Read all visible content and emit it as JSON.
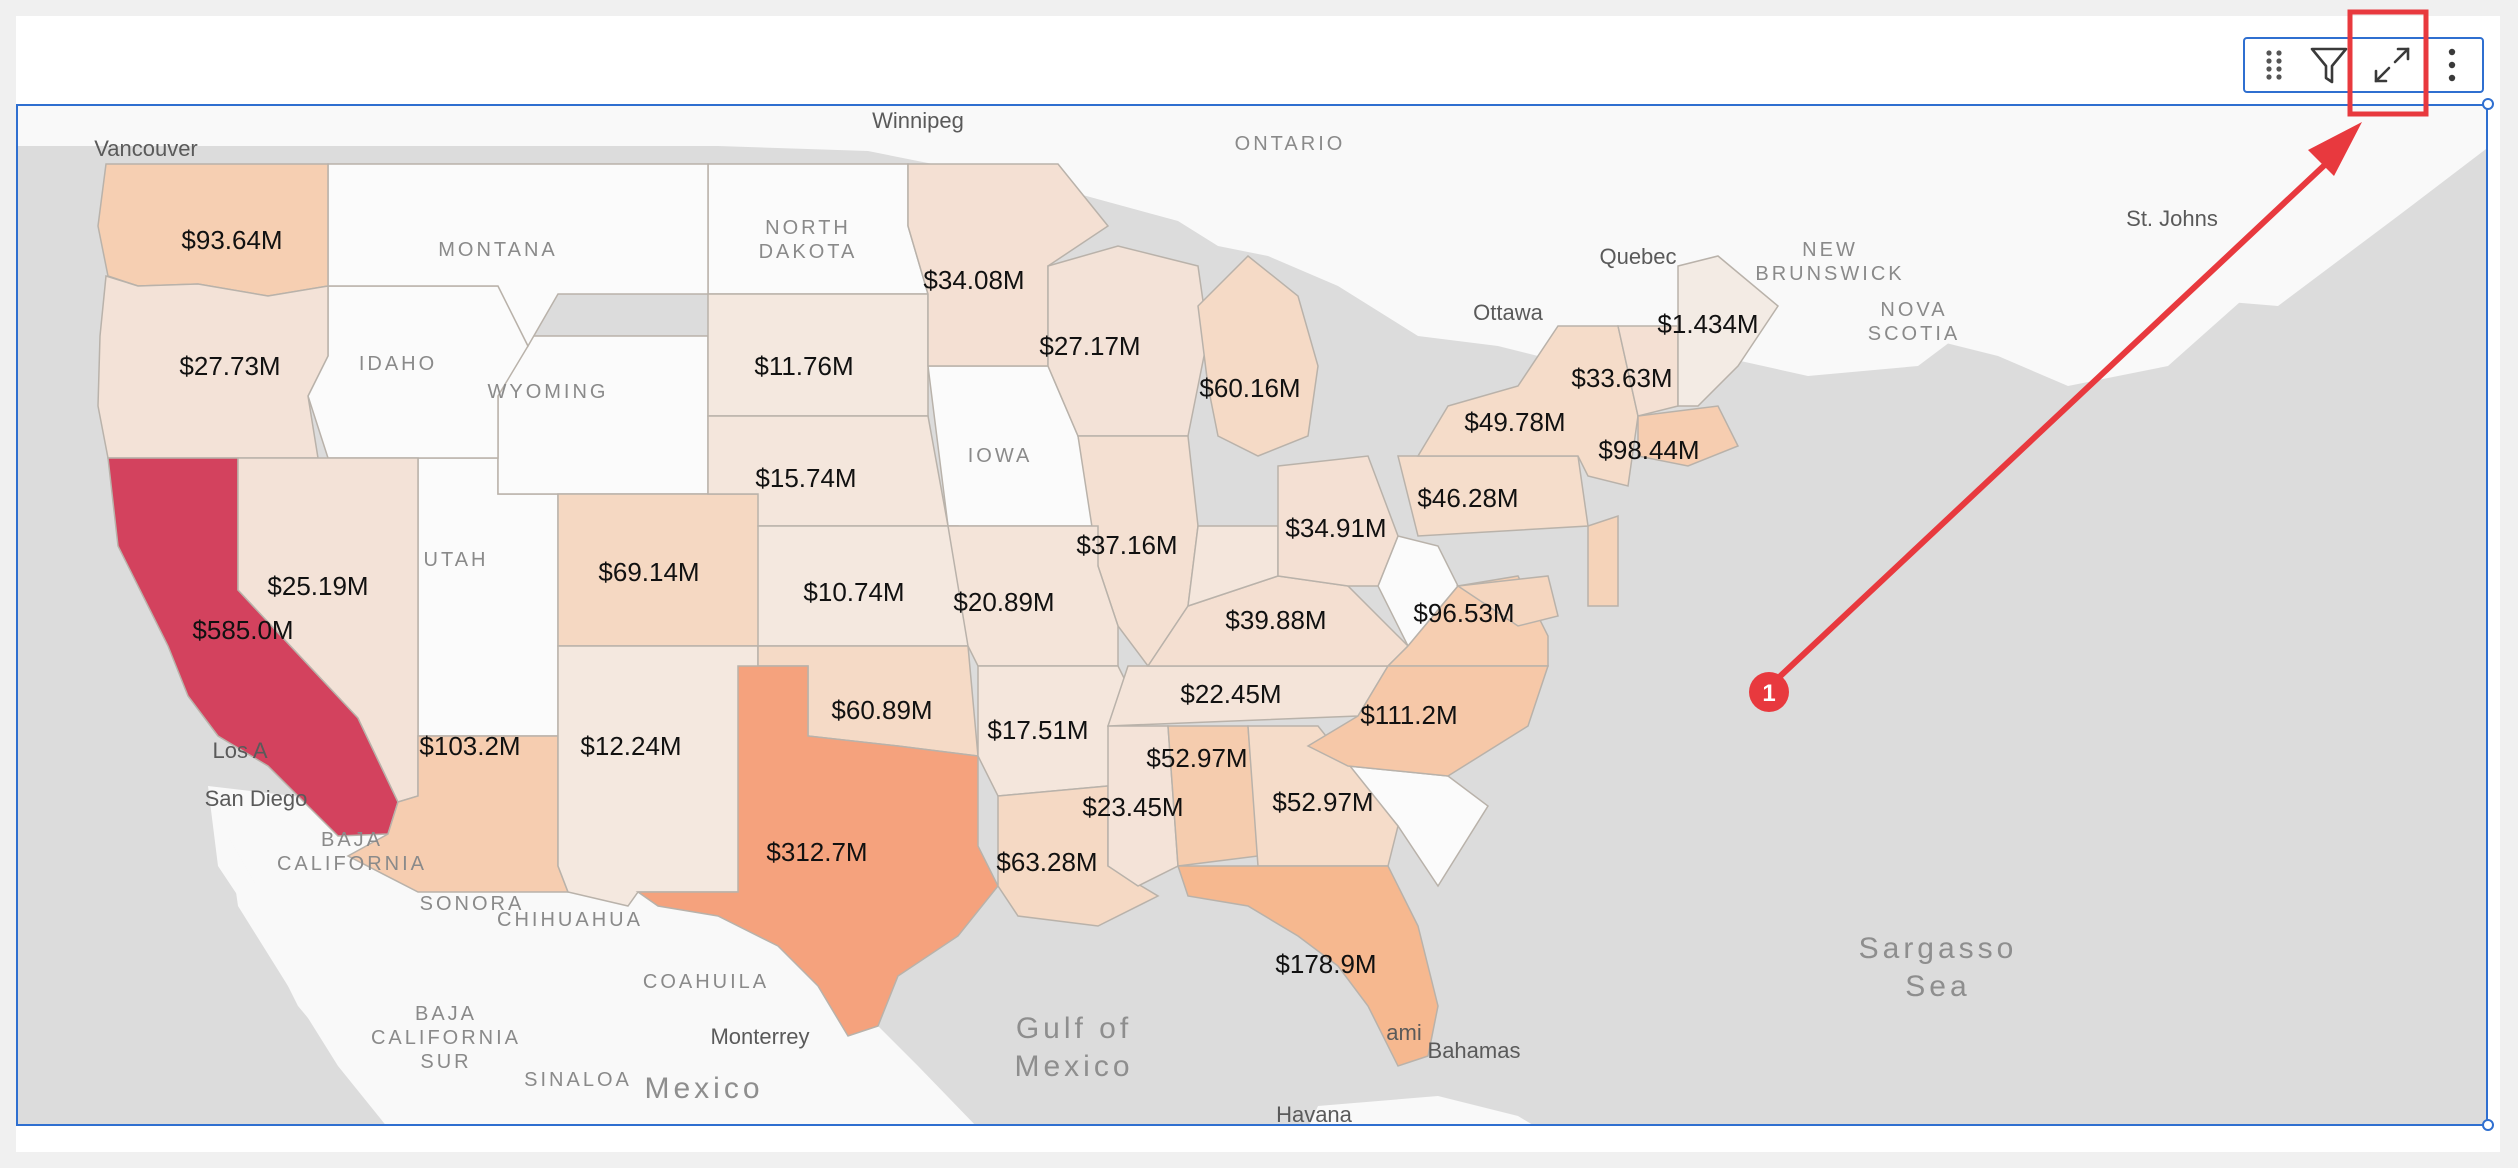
{
  "toolbar": {
    "drag_icon": "drag-handle-icon",
    "filter_icon": "filter-icon",
    "expand_icon": "expand-icon",
    "more_icon": "more-vertical-icon"
  },
  "annotation": {
    "callout_number": "1",
    "color": "#e8393e"
  },
  "map": {
    "place_labels": {
      "vancouver": "Vancouver",
      "winnipeg": "Winnipeg",
      "ontario": "ONTARIO",
      "quebec": "Quebec",
      "new_brunswick": "NEW\nBRUNSWICK",
      "nova_scotia": "NOVA\nSCOTIA",
      "st_johns": "St. Johns",
      "ottawa": "Ottawa",
      "montana": "MONTANA",
      "north_dakota": "NORTH\nDAKOTA",
      "idaho": "IDAHO",
      "wyoming": "WYOMING",
      "utah": "UTAH",
      "iowa": "IOWA",
      "los_angeles": "Los A",
      "san_diego": "San Diego",
      "baja_california": "BAJA\nCALIFORNIA",
      "sonora": "SONORA",
      "chihuahua": "CHIHUAHUA",
      "coahuila": "COAHUILA",
      "baja_california_sur": "BAJA\nCALIFORNIA\nSUR",
      "sinaloa": "SINALOA",
      "monterrey": "Monterrey",
      "mexico": "Mexico",
      "gulf_of_mexico": "Gulf of\nMexico",
      "bahamas": "Bahamas",
      "havana": "Havana",
      "sargasso_sea": "Sargasso\nSea",
      "miami": "ami"
    },
    "states": [
      {
        "state": "Washington",
        "label": "$93.64M",
        "value": 93.64,
        "color": "#f6cfb2"
      },
      {
        "state": "Oregon",
        "label": "$27.73M",
        "value": 27.73,
        "color": "#f3e2d7"
      },
      {
        "state": "California",
        "label": "$585.0M",
        "value": 585.0,
        "color": "#d3425e"
      },
      {
        "state": "Nevada",
        "label": "$25.19M",
        "value": 25.19,
        "color": "#f3e2d7"
      },
      {
        "state": "Arizona",
        "label": "$103.2M",
        "value": 103.2,
        "color": "#f6cdb0"
      },
      {
        "state": "Colorado",
        "label": "$69.14M",
        "value": 69.14,
        "color": "#f5d8c2"
      },
      {
        "state": "New Mexico",
        "label": "$12.24M",
        "value": 12.24,
        "color": "#f4e8df"
      },
      {
        "state": "South Dakota",
        "label": "$11.76M",
        "value": 11.76,
        "color": "#f4e8df"
      },
      {
        "state": "Nebraska",
        "label": "$15.74M",
        "value": 15.74,
        "color": "#f4e6dc"
      },
      {
        "state": "Kansas",
        "label": "$10.74M",
        "value": 10.74,
        "color": "#f4e8df"
      },
      {
        "state": "Oklahoma",
        "label": "$60.89M",
        "value": 60.89,
        "color": "#f5dac6"
      },
      {
        "state": "Texas",
        "label": "$312.7M",
        "value": 312.7,
        "color": "#f5a27d"
      },
      {
        "state": "Minnesota",
        "label": "$34.08M",
        "value": 34.08,
        "color": "#f4e0d3"
      },
      {
        "state": "Wisconsin",
        "label": "$27.17M",
        "value": 27.17,
        "color": "#f3e2d7"
      },
      {
        "state": "Michigan",
        "label": "$60.16M",
        "value": 60.16,
        "color": "#f5dac6"
      },
      {
        "state": "Illinois",
        "label": "$37.16M",
        "value": 37.16,
        "color": "#f4e0d2"
      },
      {
        "state": "Missouri",
        "label": "$20.89M",
        "value": 20.89,
        "color": "#f4e4d9"
      },
      {
        "state": "Arkansas",
        "label": "$17.51M",
        "value": 17.51,
        "color": "#f4e6dc"
      },
      {
        "state": "Louisiana",
        "label": "$63.28M",
        "value": 63.28,
        "color": "#f5d9c4"
      },
      {
        "state": "Mississippi",
        "label": "$23.45M",
        "value": 23.45,
        "color": "#f4e3d8"
      },
      {
        "state": "Alabama",
        "label": "$52.97M",
        "value": 52.97,
        "color": "#f5ccae"
      },
      {
        "state": "Georgia",
        "label": "$52.97M",
        "value": 52.97,
        "color": "#f5dcc9"
      },
      {
        "state": "Florida",
        "label": "$178.9M",
        "value": 178.9,
        "color": "#f6b88f"
      },
      {
        "state": "Tennessee",
        "label": "$22.45M",
        "value": 22.45,
        "color": "#f4e4d9"
      },
      {
        "state": "Kentucky",
        "label": "$39.88M",
        "value": 39.88,
        "color": "#f4dfd1"
      },
      {
        "state": "Indiana",
        "label": "",
        "value": null,
        "color": "#f4e6dc"
      },
      {
        "state": "Ohio",
        "label": "$34.91M",
        "value": 34.91,
        "color": "#f4e0d3"
      },
      {
        "state": "Pennsylvania",
        "label": "$46.28M",
        "value": 46.28,
        "color": "#f5ddcb"
      },
      {
        "state": "Virginia",
        "label": "$96.53M",
        "value": 96.53,
        "color": "#f6ceb1"
      },
      {
        "state": "North Carolina",
        "label": "$111.2M",
        "value": 111.2,
        "color": "#f6c8a8"
      },
      {
        "state": "New York",
        "label": "$49.78M",
        "value": 49.78,
        "color": "#f5dcc9"
      },
      {
        "state": "Massachusetts",
        "label": "$98.44M",
        "value": 98.44,
        "color": "#f6cdb0"
      },
      {
        "state": "Vermont / New Hampshire",
        "label": "$33.63M",
        "value": 33.63,
        "color": "#f4e0d3"
      },
      {
        "state": "Maine",
        "label": "$1.434M",
        "value": 1.434,
        "color": "#f3ebe4"
      },
      {
        "state": "New Jersey",
        "label": "",
        "value": null,
        "color": "#f5d3b9"
      },
      {
        "state": "Maryland",
        "label": "",
        "value": null,
        "color": "#f5d6bf"
      }
    ],
    "unfilled_color": "#fbfbfb",
    "ocean_color": "#dcdcdc",
    "land_color": "#f9f9f9"
  }
}
